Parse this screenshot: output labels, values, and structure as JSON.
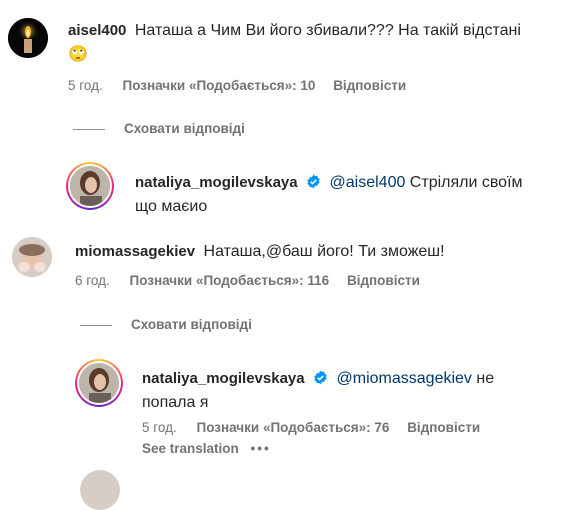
{
  "comments": [
    {
      "username": "aisel400",
      "text": "Наташа а Чим Ви його збивали??? На такій відстані",
      "emoji": "🙄",
      "time": "5 год.",
      "likes": "Позначки «Подобається»: 10",
      "reply": "Відповісти"
    },
    {
      "username": "miomassagekiev",
      "text": "Наташа,@баш його! Ти зможеш!",
      "time": "6 год.",
      "likes": "Позначки «Подобається»: 116",
      "reply": "Відповісти"
    }
  ],
  "replies": [
    {
      "username": "nataliya_mogilevskaya",
      "mention": "@aisel400",
      "text_line1": " Стріляли своїм",
      "text_line2": "що маєио"
    },
    {
      "username": "nataliya_mogilevskaya",
      "mention": "@miomassagekiev",
      "text_line1": " не",
      "text_line2": "попала я",
      "time": "5 год.",
      "likes": "Позначки «Подобається»: 76",
      "reply": "Відповісти",
      "see_translation": "See translation",
      "more": "•••"
    }
  ],
  "hide_replies": "Сховати відповіді",
  "colors": {
    "verified": "#0095f6",
    "mention": "#00376b",
    "meta": "#737373"
  }
}
